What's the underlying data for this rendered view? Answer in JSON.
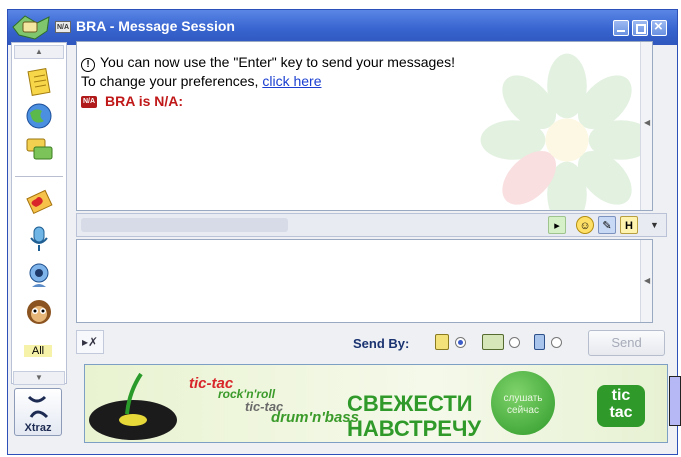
{
  "window": {
    "title": "BRA - Message Session",
    "status_badge": "N/A"
  },
  "chat": {
    "line1": "You can now use the \"Enter\" key to send your messages!",
    "line2_prefix": "To change your preferences, ",
    "line2_link": "click here",
    "status_line": "BRA is N/A:"
  },
  "sidebar": {
    "all_label": "All"
  },
  "bottom": {
    "send_by_label": "Send By:",
    "send_label": "Send",
    "xtraz_label": "Xtraz",
    "selected_mode": "message"
  },
  "toolbar": {
    "font_button_label": "H"
  },
  "banner": {
    "brand1": "tic-tac",
    "genre1": "rock'n'roll",
    "brand2": "tic-tac",
    "genre2": "drum'n'bass",
    "headline1": "СВЕЖЕСТИ",
    "headline2": "НАВСТРЕЧУ",
    "cta_line1": "слушать",
    "cta_line2": "сейчас",
    "logo_line1": "tic",
    "logo_line2": "tac"
  },
  "colors": {
    "title_bar": "#3764cf",
    "status_red": "#c01818",
    "link_blue": "#1a3fd0",
    "banner_green": "#2f9a2a"
  },
  "icons": [
    "logo-icon",
    "notes-icon",
    "globe-icon",
    "chat-icon",
    "greeting-card-icon",
    "microphone-icon",
    "webcam-icon",
    "monkey-icon",
    "xtraz-icon",
    "info-icon",
    "flower-watermark-icon"
  ]
}
